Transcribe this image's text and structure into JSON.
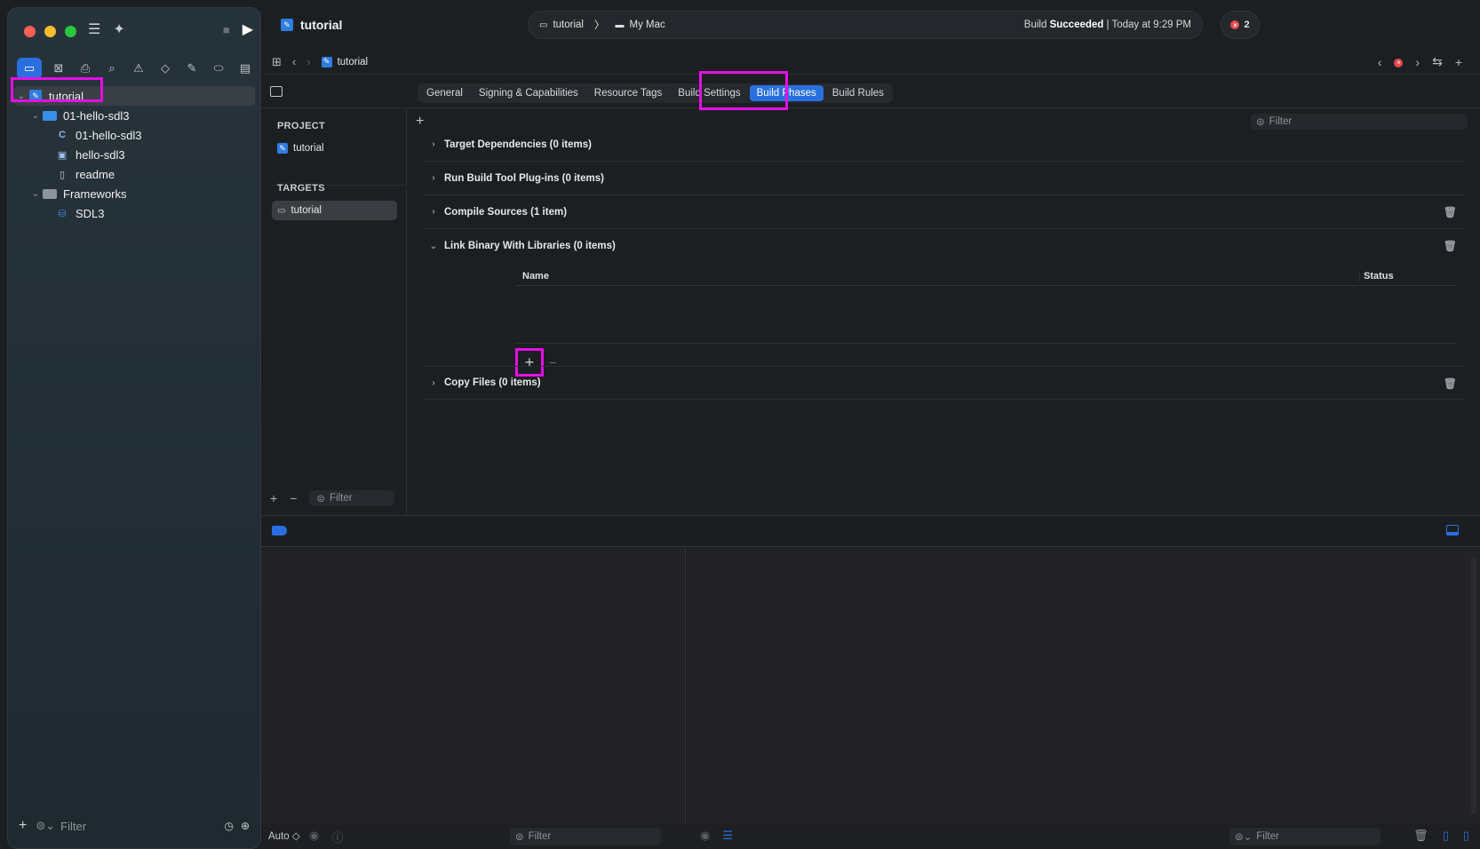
{
  "window": {
    "project_name": "tutorial"
  },
  "toolbar": {
    "title": "tutorial",
    "scheme_target": "tutorial",
    "destination": "My Mac",
    "status_prefix": "Build",
    "status_bold": "Succeeded",
    "status_suffix": "| Today at 9:29 PM",
    "error_count": "2"
  },
  "sidebar": {
    "filter_placeholder": "Filter",
    "tree": [
      {
        "label": "tutorial",
        "level": 0,
        "icon": "project-icon",
        "expanded": true,
        "selected": true
      },
      {
        "label": "01-hello-sdl3",
        "level": 1,
        "icon": "folder-icon",
        "expanded": true
      },
      {
        "label": "01-hello-sdl3",
        "level": 2,
        "icon": "c-source-icon"
      },
      {
        "label": "hello-sdl3",
        "level": 2,
        "icon": "image-icon"
      },
      {
        "label": "readme",
        "level": 2,
        "icon": "text-file-icon"
      },
      {
        "label": "Frameworks",
        "level": 1,
        "icon": "folder-icon",
        "expanded": true
      },
      {
        "label": "SDL3",
        "level": 2,
        "icon": "framework-icon"
      }
    ]
  },
  "jumpbar": {
    "crumb": "tutorial"
  },
  "tabs": {
    "items": [
      "General",
      "Signing & Capabilities",
      "Resource Tags",
      "Build Settings",
      "Build Phases",
      "Build Rules"
    ],
    "active": "Build Phases"
  },
  "targets_panel": {
    "project_header": "PROJECT",
    "project_item": "tutorial",
    "targets_header": "TARGETS",
    "target_item": "tutorial",
    "filter_placeholder": "Filter"
  },
  "phases": {
    "filter_placeholder": "Filter",
    "items": [
      {
        "title": "Target Dependencies (0 items)",
        "expanded": false,
        "trash": false
      },
      {
        "title": "Run Build Tool Plug-ins (0 items)",
        "expanded": false,
        "trash": false
      },
      {
        "title": "Compile Sources (1 item)",
        "expanded": false,
        "trash": true
      },
      {
        "title": "Link Binary With Libraries (0 items)",
        "expanded": true,
        "trash": true
      },
      {
        "title": "Copy Files (0 items)",
        "expanded": false,
        "trash": true
      }
    ],
    "table": {
      "col_name": "Name",
      "col_status": "Status"
    }
  },
  "debug": {
    "auto_label": "Auto ◇",
    "variables_filter": "Filter",
    "console_filter": "Filter"
  },
  "colors": {
    "accent": "#2a6fe0",
    "highlight": "#e60fe6",
    "error": "#e5484d"
  }
}
